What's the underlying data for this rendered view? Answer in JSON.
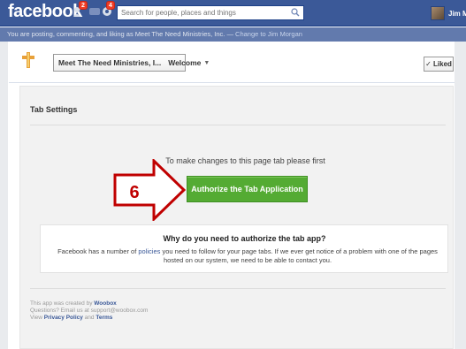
{
  "topbar": {
    "logo": "facebook",
    "notif_friends": "2",
    "notif_global": "4",
    "search_placeholder": "Search for people, places and things",
    "user_name": "Jim Morg"
  },
  "posting_bar": {
    "text": "You are posting, commenting, and liking as Meet The Need Ministries, Inc. — ",
    "link": "Change to Jim Morgan"
  },
  "page_header": {
    "page_name": "Meet The Need Ministries, I...",
    "tab_name": "Welcome",
    "liked_label": "✓ Liked"
  },
  "tab_settings": {
    "title": "Tab Settings",
    "instruction": "To make changes to this page tab please first",
    "authorize_button": "Authorize the Tab Application",
    "step_number": "6"
  },
  "why": {
    "title": "Why do you need to authorize the tab app?",
    "text_before": "Facebook has a number of ",
    "policies_link": "policies",
    "text_after": " you need to follow for your page tabs. If we ever get notice of a problem with one of the pages hosted on our system, we need to be able to contact you."
  },
  "footer": {
    "created_by_prefix": "This app was created by ",
    "creator": "Woobox",
    "questions": "Questions? Email us at support@woobox.com",
    "view_prefix": "View ",
    "privacy_link": "Privacy Policy",
    "and": " and ",
    "terms_link": "Terms"
  },
  "colors": {
    "facebook_blue": "#3b5998",
    "authorize_green": "#54ab33",
    "annotation_red": "#c00000"
  }
}
